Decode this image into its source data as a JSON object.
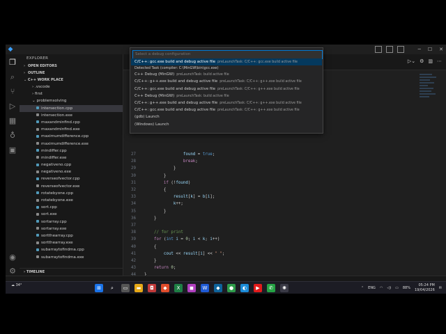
{
  "sidebar": {
    "header": "EXPLORER",
    "open_editors": "OPEN EDITORS",
    "outline": "OUTLINE",
    "workspace": "C++ WORK PLACE",
    "timeline": "TIMELINE",
    "items": [
      {
        "label": ".vscode",
        "kind": "folder"
      },
      {
        "label": "first",
        "kind": "folder"
      },
      {
        "label": "problemsolving",
        "kind": "folder-open"
      },
      {
        "label": "intersection.cpp",
        "kind": "cpp",
        "selected": true
      },
      {
        "label": "intersection.exe",
        "kind": "exe"
      },
      {
        "label": "maxandminfind.cpp",
        "kind": "cpp"
      },
      {
        "label": "maxandminfind.exe",
        "kind": "exe"
      },
      {
        "label": "maximumdifference.cpp",
        "kind": "cpp"
      },
      {
        "label": "maximumdifference.exe",
        "kind": "exe"
      },
      {
        "label": "mindiffer.cpp",
        "kind": "cpp"
      },
      {
        "label": "mindiffer.exe",
        "kind": "exe"
      },
      {
        "label": "negativeno.cpp",
        "kind": "cpp"
      },
      {
        "label": "negativeno.exe",
        "kind": "exe"
      },
      {
        "label": "reverseofvector.cpp",
        "kind": "cpp"
      },
      {
        "label": "reverseofvector.exe",
        "kind": "exe"
      },
      {
        "label": "rotatebyone.cpp",
        "kind": "cpp"
      },
      {
        "label": "rotatebyone.exe",
        "kind": "exe"
      },
      {
        "label": "sort.cpp",
        "kind": "cpp"
      },
      {
        "label": "sort.exe",
        "kind": "exe"
      },
      {
        "label": "sortarray.cpp",
        "kind": "cpp"
      },
      {
        "label": "sortarray.exe",
        "kind": "exe"
      },
      {
        "label": "sortthearray.cpp",
        "kind": "cpp"
      },
      {
        "label": "sortthearray.exe",
        "kind": "exe"
      },
      {
        "label": "subarraytofindma.cpp",
        "kind": "cpp"
      },
      {
        "label": "subarraytofindma.exe",
        "kind": "exe"
      }
    ]
  },
  "quickpick": {
    "placeholder": "Select a debug configuration",
    "items": [
      {
        "label": "C/C++: gcc.exe build and debug active file",
        "desc": "preLaunchTask: C/C++: gcc.exe build active file",
        "selected": true
      },
      {
        "label": "C++ Debug (MinGW)",
        "desc": "preLaunchTask: build active file"
      },
      {
        "label": "C/C++: g++.exe build and debug active file",
        "desc": "preLaunchTask: C/C++: g++.exe build active file"
      },
      {
        "label": "C/C++: gcc.exe build and debug active file",
        "desc": "preLaunchTask: C/C++: g++.exe build active file"
      },
      {
        "label": "C++ Debug (MinGW)",
        "desc": "preLaunchTask: build active file"
      },
      {
        "label": "C/C++: g++.exe build and debug active file",
        "desc": "preLaunchTask: C/C++: g++.exe build active file"
      },
      {
        "label": "C/C++: gcc.exe build and debug active file",
        "desc": "preLaunchTask: C/C++: g++.exe build active file"
      },
      {
        "label": "(gdb) Launch",
        "desc": ""
      },
      {
        "label": "(Windows) Launch",
        "desc": ""
      }
    ],
    "detail": "Detected Task (compiler: C:\\MinGW\\bin\\gcc.exe)"
  },
  "code": [
    {
      "n": "27",
      "html": "                <span class=\"var\">found</span> = <span class=\"kw\">true</span>;"
    },
    {
      "n": "28",
      "html": "                <span class=\"kw2\">break</span>;"
    },
    {
      "n": "29",
      "html": "            }"
    },
    {
      "n": "30",
      "html": "        }"
    },
    {
      "n": "31",
      "html": "        <span class=\"kw2\">if</span> (!<span class=\"var\">found</span>)"
    },
    {
      "n": "32",
      "html": "        {"
    },
    {
      "n": "33",
      "html": "            <span class=\"var\">result</span>[<span class=\"var\">k</span>] = <span class=\"var\">b</span>[<span class=\"var\">i</span>];"
    },
    {
      "n": "34",
      "html": "            <span class=\"var\">k</span>++;"
    },
    {
      "n": "35",
      "html": "        }"
    },
    {
      "n": "36",
      "html": "    }"
    },
    {
      "n": "37",
      "html": ""
    },
    {
      "n": "38",
      "html": "    <span class=\"cmt\">// for print</span>"
    },
    {
      "n": "39",
      "html": "    <span class=\"kw2\">for</span> (<span class=\"kw\">int</span> <span class=\"var\">i</span> = <span class=\"num\">0</span>; <span class=\"var\">i</span> &lt; <span class=\"var\">k</span>; <span class=\"var\">i</span>++)"
    },
    {
      "n": "40",
      "html": "    {"
    },
    {
      "n": "41",
      "html": "        <span class=\"var\">cout</span> &lt;&lt; <span class=\"var\">result</span>[<span class=\"var\">i</span>] &lt;&lt; <span class=\"str\">\" \"</span>;"
    },
    {
      "n": "42",
      "html": "    }"
    },
    {
      "n": "43",
      "html": "    <span class=\"kw2\">return</span> <span class=\"num\">0</span>;"
    },
    {
      "n": "44",
      "html": "}"
    }
  ],
  "taskbar": {
    "weather_temp": "34°",
    "lang": "ENG",
    "battery": "88%",
    "time": "05:24 PM",
    "date": "19/04/2026"
  }
}
